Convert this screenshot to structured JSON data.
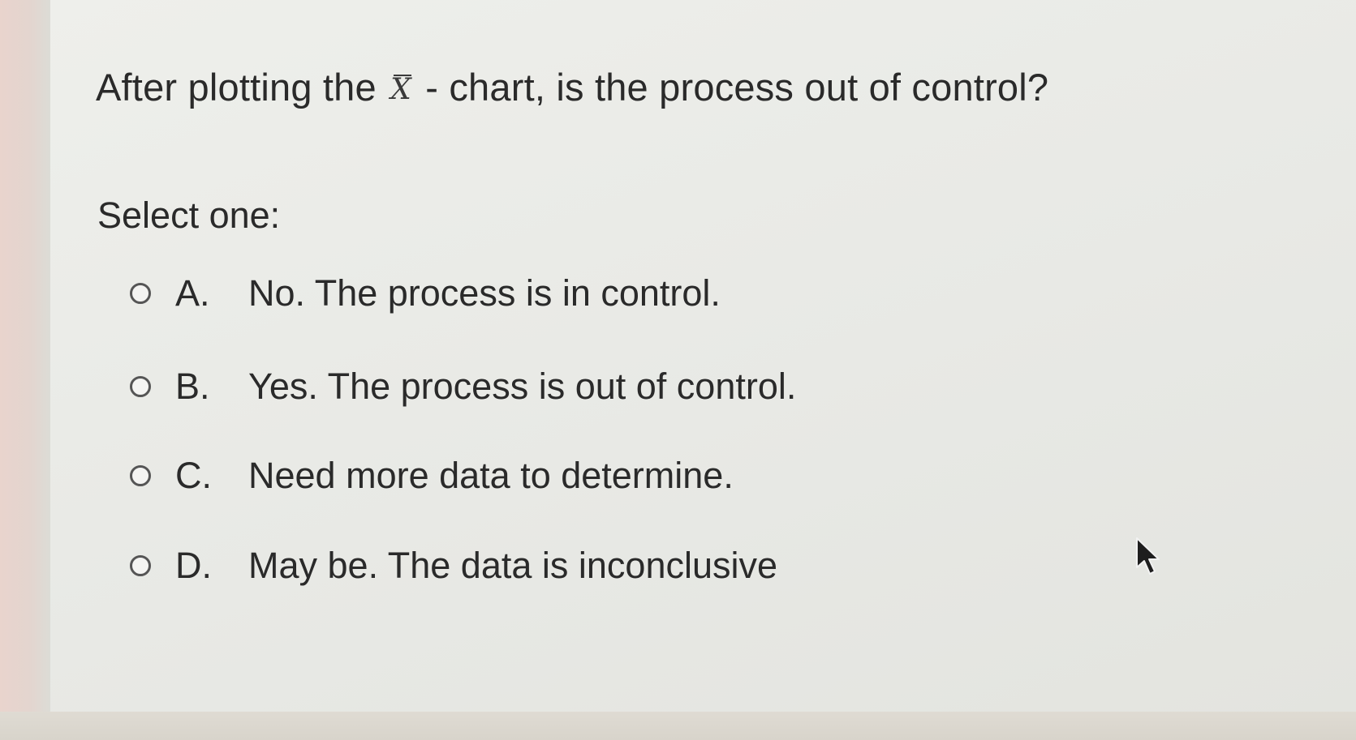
{
  "question": {
    "prefix": "After plotting the",
    "symbol": "X",
    "suffix": "- chart, is the process out of control?"
  },
  "prompt": "Select one:",
  "options": [
    {
      "letter": "A.",
      "text": "No. The process is in control.",
      "selected": false
    },
    {
      "letter": "B.",
      "text": "Yes. The process is out of control.",
      "selected": false
    },
    {
      "letter": "C.",
      "text": "Need more data to determine.",
      "selected": false
    },
    {
      "letter": "D.",
      "text": "May be. The data is inconclusive",
      "selected": false
    }
  ],
  "icons": {
    "radio": "radio-circle-icon",
    "cursor": "mouse-pointer-icon"
  },
  "colors": {
    "text": "#2a2a2a",
    "background": "#e8e9e5",
    "radio_border": "#555555"
  }
}
